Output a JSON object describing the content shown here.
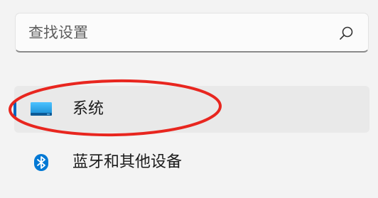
{
  "search": {
    "placeholder": "查找设置",
    "value": ""
  },
  "nav": {
    "items": [
      {
        "label": "系统",
        "icon": "display-icon",
        "selected": true
      },
      {
        "label": "蓝牙和其他设备",
        "icon": "bluetooth-icon",
        "selected": false
      }
    ]
  },
  "colors": {
    "accent": "#0067c0",
    "annotation": "#e8261f"
  }
}
